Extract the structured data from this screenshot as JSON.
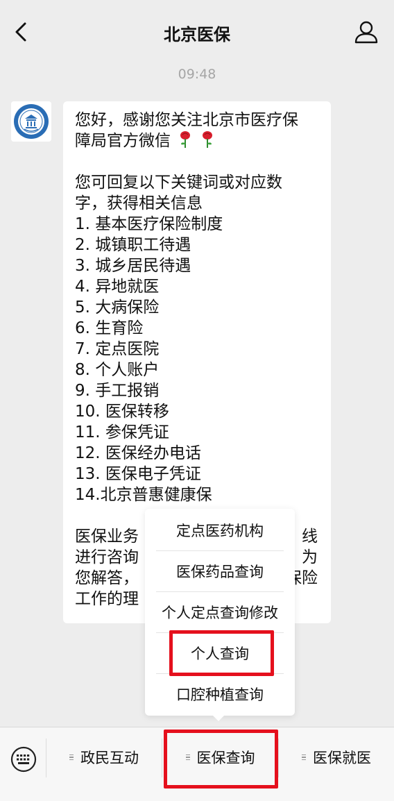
{
  "header": {
    "title": "北京医保",
    "back_icon": "chevron-left-icon",
    "profile_icon": "person-icon"
  },
  "chat": {
    "time": "09:48",
    "avatar_icon": "beijing-medical-insurance-bureau-seal",
    "message": {
      "greeting": [
        "您好，感谢您关注北京市医疗保",
        "障局官方微信"
      ],
      "greeting_emoji": "rose-emoji",
      "intro": [
        "您可回复以下关键词或对应数",
        "字，获得相关信息"
      ],
      "items": [
        "1. 基本医疗保险制度",
        "2. 城镇职工待遇",
        "3. 城乡居民待遇",
        "4. 异地就医",
        "5. 大病保险",
        "6. 生育险",
        "7. 定点医院",
        "8. 个人账户",
        "9. 手工报销",
        "10. 医保转移",
        "11. 参保凭证",
        "12. 医保经办电话",
        "13. 医保电子凭证",
        "14.北京普惠健康保"
      ],
      "closing": [
        "医保业务",
        "进行咨询",
        "您解答，",
        "工作的理"
      ],
      "closing_right": [
        "线",
        "为",
        "保险",
        ""
      ]
    }
  },
  "popup_menu": {
    "items": [
      "定点医药机构",
      "医保药品查询",
      "个人定点查询修改",
      "个人查询",
      "口腔种植查询"
    ],
    "highlighted": "个人查询"
  },
  "bottom_menu": {
    "keyboard_icon": "keyboard-icon",
    "menus": [
      "政民互动",
      "医保查询",
      "医保就医"
    ],
    "highlighted": "医保查询"
  },
  "colors": {
    "background": "#ededed",
    "bubble": "#ffffff",
    "highlight": "#e5101d",
    "time_text": "#a6a6a6"
  }
}
